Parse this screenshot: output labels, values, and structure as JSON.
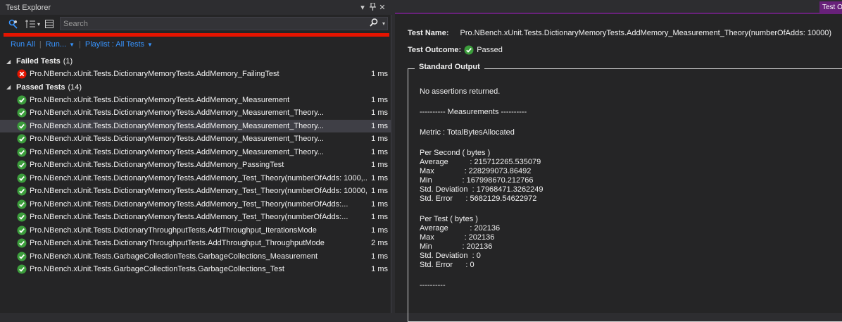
{
  "panel": {
    "title": "Test Explorer",
    "controls": {
      "dropdown": "▾",
      "pin": "ⵖ",
      "close": "✕"
    }
  },
  "toolbar": {
    "search_placeholder": "Search",
    "run_all": "Run All",
    "run": "Run...",
    "playlist": "Playlist : All Tests",
    "separator": "|"
  },
  "groups": {
    "failed": {
      "label": "Failed Tests",
      "count": "(1)",
      "tests": [
        {
          "name": "Pro.NBench.xUnit.Tests.DictionaryMemoryTests.AddMemory_FailingTest",
          "duration": "1 ms",
          "status": "failed"
        }
      ]
    },
    "passed": {
      "label": "Passed Tests",
      "count": "(14)",
      "tests": [
        {
          "name": "Pro.NBench.xUnit.Tests.DictionaryMemoryTests.AddMemory_Measurement",
          "duration": "1 ms",
          "status": "passed"
        },
        {
          "name": "Pro.NBench.xUnit.Tests.DictionaryMemoryTests.AddMemory_Measurement_Theory...",
          "duration": "1 ms",
          "status": "passed"
        },
        {
          "name": "Pro.NBench.xUnit.Tests.DictionaryMemoryTests.AddMemory_Measurement_Theory...",
          "duration": "1 ms",
          "status": "passed"
        },
        {
          "name": "Pro.NBench.xUnit.Tests.DictionaryMemoryTests.AddMemory_Measurement_Theory...",
          "duration": "1 ms",
          "status": "passed"
        },
        {
          "name": "Pro.NBench.xUnit.Tests.DictionaryMemoryTests.AddMemory_Measurement_Theory...",
          "duration": "1 ms",
          "status": "passed"
        },
        {
          "name": "Pro.NBench.xUnit.Tests.DictionaryMemoryTests.AddMemory_PassingTest",
          "duration": "1 ms",
          "status": "passed"
        },
        {
          "name": "Pro.NBench.xUnit.Tests.DictionaryMemoryTests.AddMemory_Test_Theory(numberOfAdds: 1000,...",
          "duration": "1 ms",
          "status": "passed"
        },
        {
          "name": "Pro.NBench.xUnit.Tests.DictionaryMemoryTests.AddMemory_Test_Theory(numberOfAdds: 10000,...",
          "duration": "1 ms",
          "status": "passed"
        },
        {
          "name": "Pro.NBench.xUnit.Tests.DictionaryMemoryTests.AddMemory_Test_Theory(numberOfAdds:...",
          "duration": "1 ms",
          "status": "passed"
        },
        {
          "name": "Pro.NBench.xUnit.Tests.DictionaryMemoryTests.AddMemory_Test_Theory(numberOfAdds:...",
          "duration": "1 ms",
          "status": "passed"
        },
        {
          "name": "Pro.NBench.xUnit.Tests.DictionaryThroughputTests.AddThroughput_IterationsMode",
          "duration": "1 ms",
          "status": "passed"
        },
        {
          "name": "Pro.NBench.xUnit.Tests.DictionaryThroughputTests.AddThroughput_ThroughputMode",
          "duration": "2 ms",
          "status": "passed"
        },
        {
          "name": "Pro.NBench.xUnit.Tests.GarbageCollectionTests.GarbageCollections_Measurement",
          "duration": "1 ms",
          "status": "passed"
        },
        {
          "name": "Pro.NBench.xUnit.Tests.GarbageCollectionTests.GarbageCollections_Test",
          "duration": "1 ms",
          "status": "passed"
        }
      ]
    }
  },
  "detail": {
    "tab_label": "Test Output",
    "test_name_label": "Test Name:",
    "test_name_value": "Pro.NBench.xUnit.Tests.DictionaryMemoryTests.AddMemory_Measurement_Theory(numberOfAdds: 10000)",
    "outcome_label": "Test Outcome:",
    "outcome_value": "Passed",
    "section_title": "Standard Output",
    "output_lines": [
      "No assertions returned.",
      "",
      "---------- Measurements ----------",
      "",
      "Metric : TotalBytesAllocated",
      "",
      "Per Second ( bytes )",
      "Average          : 215712265.535079",
      "Max              : 228299073.86492",
      "Min              : 167998670.212766",
      "Std. Deviation  : 17968471.3262249",
      "Std. Error      : 5682129.54622972",
      "",
      "Per Test ( bytes )",
      "Average          : 202136",
      "Max              : 202136",
      "Min              : 202136",
      "Std. Deviation  : 0",
      "Std. Error      : 0",
      "",
      "----------"
    ]
  },
  "colors": {
    "passed": "#3c9d3c",
    "failed": "#e51400",
    "accent": "#68217a",
    "link": "#3794ff"
  }
}
